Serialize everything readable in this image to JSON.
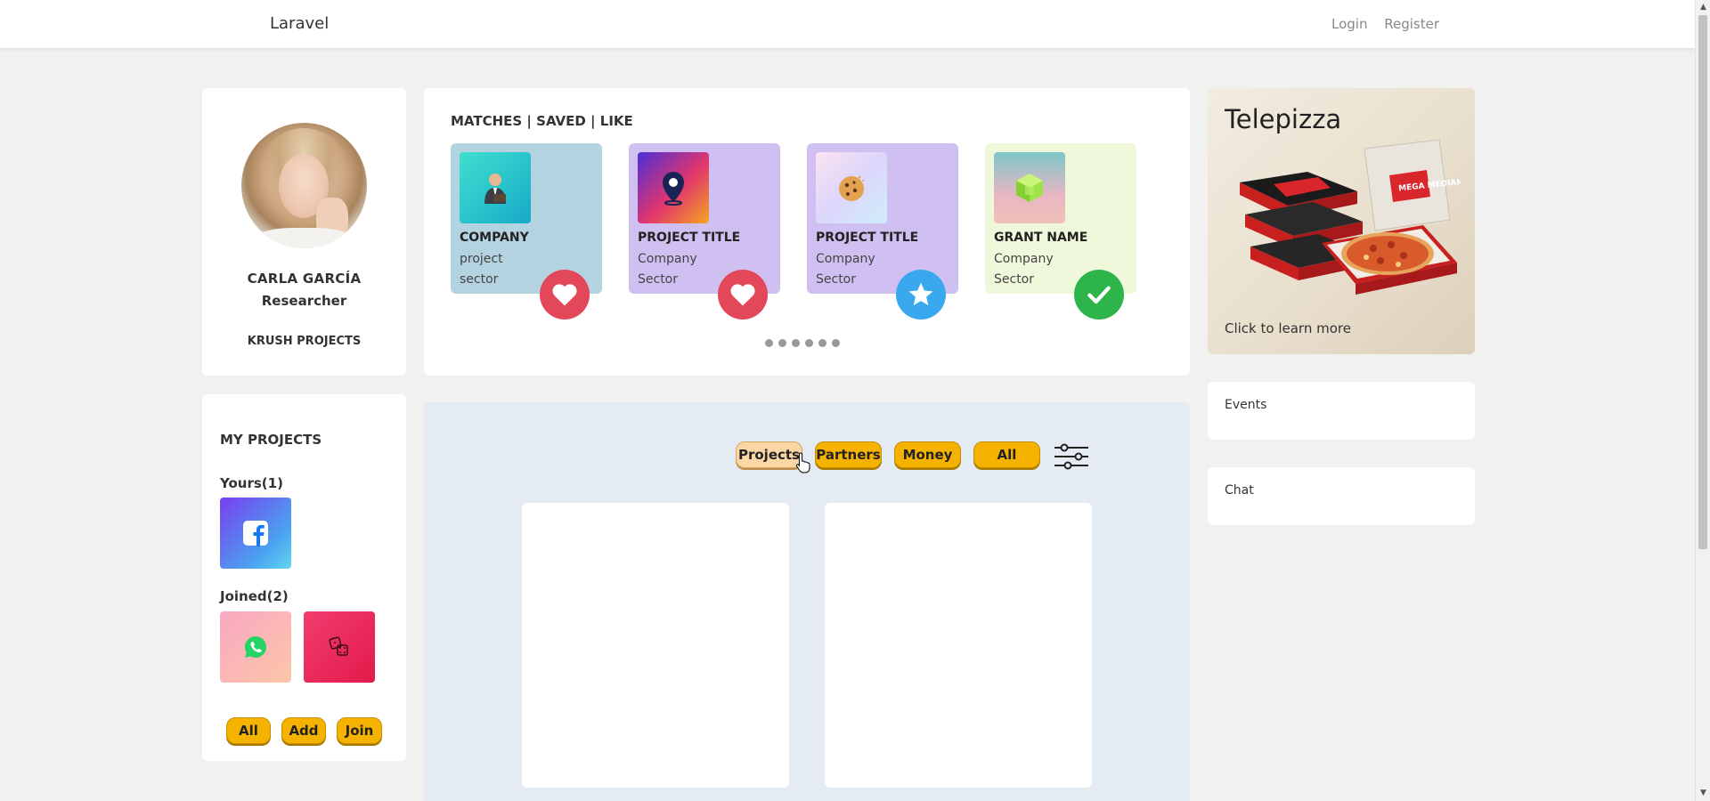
{
  "navbar": {
    "brand": "Laravel",
    "login": "Login",
    "register": "Register"
  },
  "profile": {
    "name": "CARLA GARCÍA",
    "role": "Researcher",
    "link": "KRUSH PROJECTS"
  },
  "matches": {
    "heading": "MATCHES | SAVED | LIKE",
    "cards": [
      {
        "title": "COMPANY",
        "line1": "project",
        "line2": "sector",
        "bg": "#b4d3e0",
        "badge": "heart-icon",
        "badge_color": "#e2475a",
        "icon": "businessman-icon"
      },
      {
        "title": "PROJECT TITLE",
        "line1": "Company",
        "line2": "Sector",
        "bg": "#cfc0f1",
        "badge": "heart-icon",
        "badge_color": "#e2475a",
        "icon": "map-pin-icon"
      },
      {
        "title": "PROJECT TITLE",
        "line1": "Company",
        "line2": "Sector",
        "bg": "#cfc0f1",
        "badge": "star-icon",
        "badge_color": "#3aa8ef",
        "icon": "cookie-icon"
      },
      {
        "title": "GRANT NAME",
        "line1": "Company",
        "line2": "Sector",
        "bg": "#f0f8dc",
        "badge": "check-icon",
        "badge_color": "#2db44a",
        "icon": "cube-icon"
      }
    ],
    "dot_count": 6
  },
  "ad": {
    "title": "Telepizza",
    "subtitle": "Click to learn more",
    "brand_text": "MEGA MEDIANA"
  },
  "events": {
    "label": "Events"
  },
  "chat": {
    "label": "Chat"
  },
  "my_projects": {
    "heading": "MY PROJECTS",
    "yours_label": "Yours(1)",
    "joined_label": "Joined(2)",
    "buttons": {
      "all": "All",
      "add": "Add",
      "join": "Join"
    }
  },
  "feed": {
    "filters": {
      "projects": "Projects",
      "partners": "Partners",
      "money": "Money",
      "all": "All"
    },
    "active_filter": "Projects"
  },
  "colors": {
    "accent": "#f5b300",
    "page_bg": "#f1f1ef",
    "feed_bg": "#e4ebf2"
  }
}
